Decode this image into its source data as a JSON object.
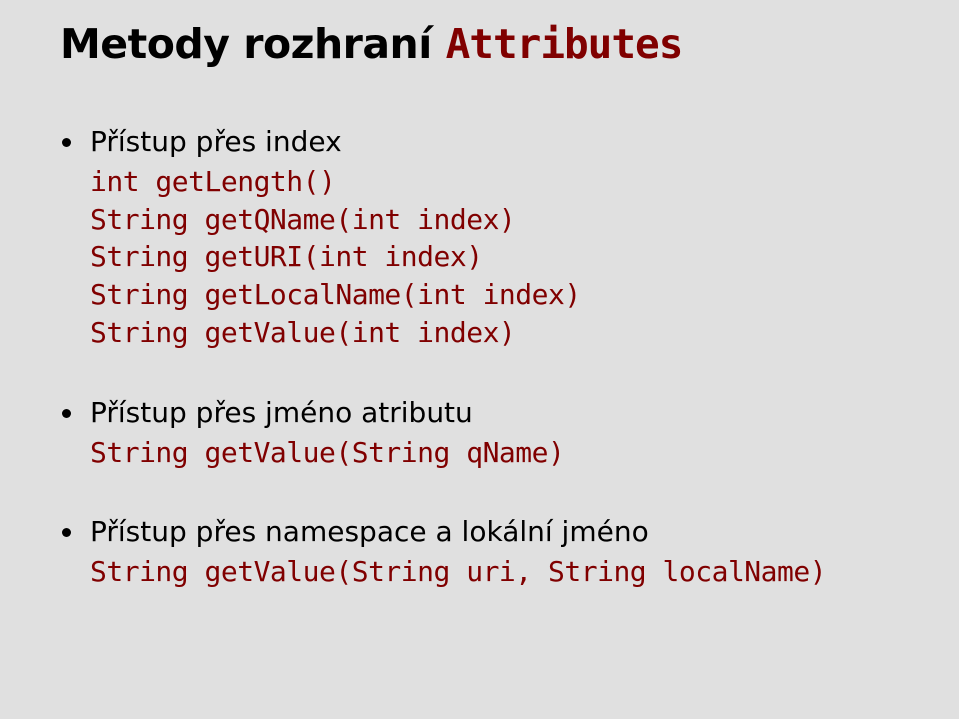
{
  "title": {
    "text": "Metody rozhraní ",
    "mono": "Attributes"
  },
  "blocks": [
    {
      "bullet": "Přístup přes index",
      "code": "int getLength()\nString getQName(int index)\nString getURI(int index)\nString getLocalName(int index)\nString getValue(int index)"
    },
    {
      "bullet": "Přístup přes jméno atributu",
      "code": "String getValue(String qName)"
    },
    {
      "bullet": "Přístup přes namespace a lokální jméno",
      "code": "String getValue(String uri, String localName)"
    }
  ]
}
